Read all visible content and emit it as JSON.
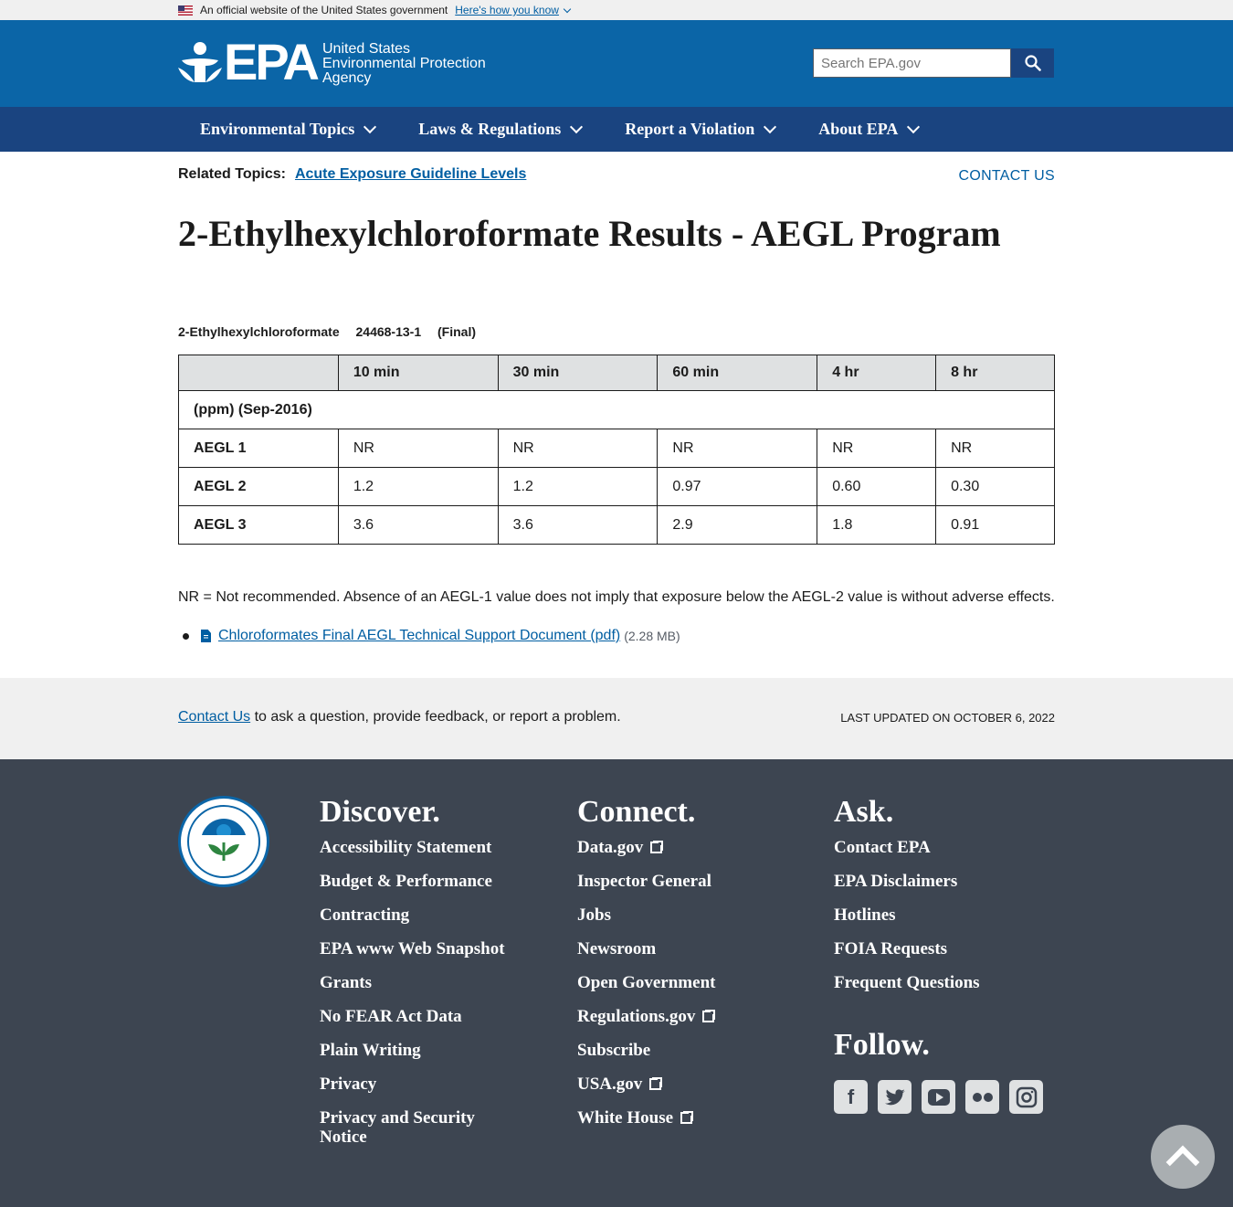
{
  "gov_banner": {
    "text": "An official website of the United States government",
    "link": "Here's how you know"
  },
  "header": {
    "logo_word": "EPA",
    "agency_line1": "United States",
    "agency_line2": "Environmental Protection",
    "agency_line3": "Agency",
    "search_placeholder": "Search EPA.gov"
  },
  "nav": {
    "items": [
      {
        "label": "Environmental Topics"
      },
      {
        "label": "Laws & Regulations"
      },
      {
        "label": "Report a Violation"
      },
      {
        "label": "About EPA"
      }
    ]
  },
  "related": {
    "label": "Related Topics:",
    "link": "Acute Exposure Guideline Levels"
  },
  "contact_top": "CONTACT US",
  "page_title": "2-Ethylhexylchloroformate Results - AEGL Program",
  "chemical": {
    "name": "2-Ethylhexylchloroformate",
    "cas": "24468-13-1",
    "status": "(Final)"
  },
  "table": {
    "headers": [
      "",
      "10 min",
      "30 min",
      "60 min",
      "4 hr",
      "8 hr"
    ],
    "units_row": "(ppm) (Sep-2016)",
    "rows": [
      {
        "label": "AEGL 1",
        "values": [
          "NR",
          "NR",
          "NR",
          "NR",
          "NR"
        ]
      },
      {
        "label": "AEGL 2",
        "values": [
          "1.2",
          "1.2",
          "0.97",
          "0.60",
          "0.30"
        ]
      },
      {
        "label": "AEGL 3",
        "values": [
          "3.6",
          "3.6",
          "2.9",
          "1.8",
          "0.91"
        ]
      }
    ]
  },
  "note": "NR = Not recommended.  Absence of an AEGL-1 value does not imply that exposure below the AEGL-2 value is without adverse effects.",
  "document": {
    "link": "Chloroformates Final AEGL Technical Support Document (pdf)",
    "size": "(2.28 MB)"
  },
  "feedback": {
    "link": "Contact Us",
    "text": " to ask a question, provide feedback, or report a problem.",
    "updated": "Last updated on October 6, 2022"
  },
  "footer": {
    "discover": {
      "title": "Discover.",
      "links": [
        "Accessibility Statement",
        "Budget & Performance",
        "Contracting",
        "EPA www Web Snapshot",
        "Grants",
        "No FEAR Act Data",
        "Plain Writing",
        "Privacy",
        "Privacy and Security Notice"
      ]
    },
    "connect": {
      "title": "Connect.",
      "links": [
        {
          "label": "Data.gov",
          "external": true
        },
        {
          "label": "Inspector General",
          "external": false
        },
        {
          "label": "Jobs",
          "external": false
        },
        {
          "label": "Newsroom",
          "external": false
        },
        {
          "label": "Open Government",
          "external": false
        },
        {
          "label": "Regulations.gov",
          "external": true
        },
        {
          "label": "Subscribe",
          "external": false
        },
        {
          "label": "USA.gov",
          "external": true
        },
        {
          "label": "White House",
          "external": true
        }
      ]
    },
    "ask": {
      "title": "Ask.",
      "links": [
        "Contact EPA",
        "EPA Disclaimers",
        "Hotlines",
        "FOIA Requests",
        "Frequent Questions"
      ]
    },
    "follow": {
      "title": "Follow.",
      "icons": [
        "facebook-icon",
        "twitter-icon",
        "youtube-icon",
        "flickr-icon",
        "instagram-icon"
      ]
    }
  },
  "colors": {
    "header_blue": "#0b65a7",
    "nav_navy": "#1a4480",
    "link_blue": "#005ea2",
    "footer_gray": "#3d4551"
  }
}
